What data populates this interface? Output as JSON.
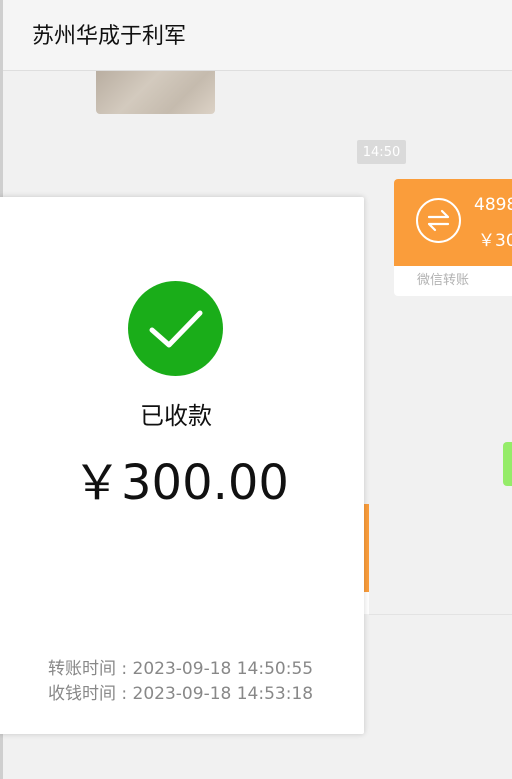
{
  "header": {
    "title": "苏州华成于利军"
  },
  "chat": {
    "timestamp": "14:50",
    "transfer": {
      "amount_line1": "4898",
      "amount_line2": "￥30",
      "footer": "微信转账"
    }
  },
  "modal": {
    "status": "已收款",
    "amount": "￥300.00",
    "transfer_time": "转账时间 : 2023-09-18 14:50:55",
    "receive_time": "收钱时间 : 2023-09-18 14:53:18"
  },
  "colors": {
    "accent_green": "#1aad19",
    "transfer_orange": "#fa9d3b",
    "bubble_green": "#95ec69"
  },
  "icons": {
    "check": "checkmark-icon",
    "transfer": "transfer-arrows-icon"
  }
}
